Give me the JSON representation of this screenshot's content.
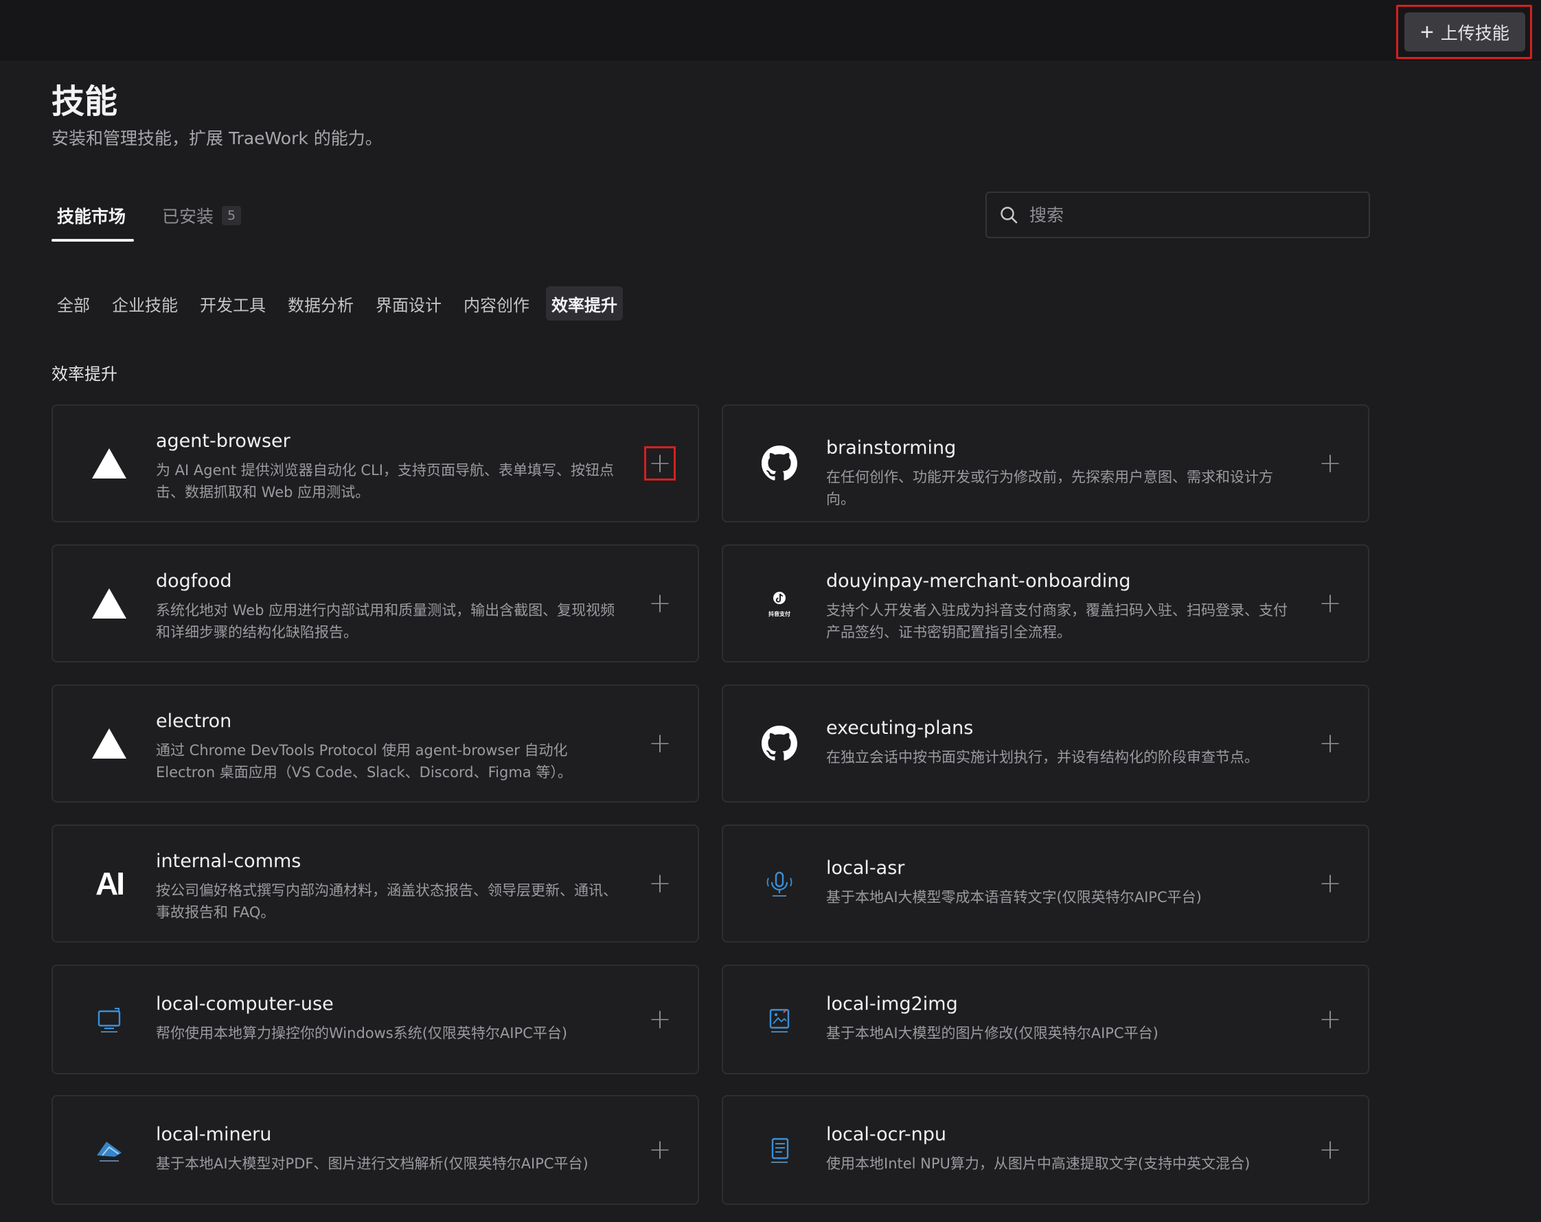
{
  "header": {
    "upload_label": "上传技能",
    "title": "技能",
    "subtitle": "安装和管理技能，扩展 TraeWork 的能力。"
  },
  "tabs": {
    "market": "技能市场",
    "installed": "已安装",
    "installed_count": "5"
  },
  "search": {
    "placeholder": "搜索"
  },
  "categories": [
    "全部",
    "企业技能",
    "开发工具",
    "数据分析",
    "界面设计",
    "内容创作",
    "效率提升"
  ],
  "active_category": "效率提升",
  "section_label": "效率提升",
  "skills": [
    {
      "name": "agent-browser",
      "icon": "triangle-icon",
      "desc": "为 AI Agent 提供浏览器自动化 CLI，支持页面导航、表单填写、按钮点击、数据抓取和 Web 应用测试。"
    },
    {
      "name": "brainstorming",
      "icon": "github-icon",
      "desc": "在任何创作、功能开发或行为修改前，先探索用户意图、需求和设计方向。"
    },
    {
      "name": "dogfood",
      "icon": "triangle-icon",
      "desc": "系统化地对 Web 应用进行内部试用和质量测试，输出含截图、复现视频和详细步骤的结构化缺陷报告。"
    },
    {
      "name": "douyinpay-merchant-onboarding",
      "icon": "douyin-pay-icon",
      "icon_text": "抖音支付",
      "desc": "支持个人开发者入驻成为抖音支付商家，覆盖扫码入驻、扫码登录、支付产品签约、证书密钥配置指引全流程。"
    },
    {
      "name": "electron",
      "icon": "triangle-icon",
      "desc": "通过 Chrome DevTools Protocol 使用 agent-browser 自动化 Electron 桌面应用（VS Code、Slack、Discord、Figma 等）。"
    },
    {
      "name": "executing-plans",
      "icon": "github-icon",
      "desc": "在独立会话中按书面实施计划执行，并设有结构化的阶段审查节点。"
    },
    {
      "name": "internal-comms",
      "icon": "anthropic-icon",
      "icon_text": "AI",
      "desc": "按公司偏好格式撰写内部沟通材料，涵盖状态报告、领导层更新、通讯、事故报告和 FAQ。"
    },
    {
      "name": "local-asr",
      "icon": "microphone-icon",
      "desc": "基于本地AI大模型零成本语音转文字(仅限英特尔AIPC平台)"
    },
    {
      "name": "local-computer-use",
      "icon": "monitor-icon",
      "desc": "帮你使用本地算力操控你的Windows系统(仅限英特尔AIPC平台)"
    },
    {
      "name": "local-img2img",
      "icon": "image-edit-icon",
      "desc": "基于本地AI大模型的图片修改(仅限英特尔AIPC平台)"
    },
    {
      "name": "local-mineru",
      "icon": "document-parse-icon",
      "desc": "基于本地AI大模型对PDF、图片进行文档解析(仅限英特尔AIPC平台)"
    },
    {
      "name": "local-ocr-npu",
      "icon": "ocr-document-icon",
      "desc": "使用本地Intel NPU算力，从图片中高速提取文字(支持中英文混合)"
    }
  ],
  "colors": {
    "background": "#1c1c1e",
    "card_border": "#2e2e32",
    "highlight_outline": "#d42020",
    "icon_blue": "#3a8fd8"
  }
}
